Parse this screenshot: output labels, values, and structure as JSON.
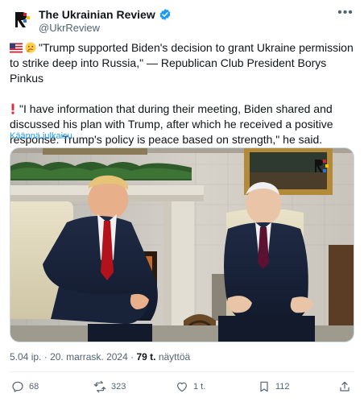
{
  "account": {
    "name": "The Ukrainian Review",
    "handle": "@UkrReview",
    "verified_icon": "verified-badge-icon",
    "logo_letter": "R",
    "brand_colors": [
      "#1d9bf0",
      "#d1242f",
      "#f5c400",
      "#2f6fd6"
    ]
  },
  "post": {
    "paragraph1": "\"Trump supported Biden's decision to grant Ukraine permission to strike deep into Russia,\" — Republican Club President Borys Pinkus",
    "paragraph2": "\"I have information that during their meeting, Biden shared and discussed his plan with Trump, after which he received a positive response. Trump's policy is peace based on strength,\" he said.",
    "translate_label": "Käännä julkaisu"
  },
  "meta": {
    "time": "5.04 ip.",
    "date": "20. marrask. 2024",
    "views_count": "79 t.",
    "views_label": "näyttöä"
  },
  "actions": {
    "replies": "68",
    "reposts": "323",
    "likes": "1 t.",
    "bookmarks": "112"
  }
}
